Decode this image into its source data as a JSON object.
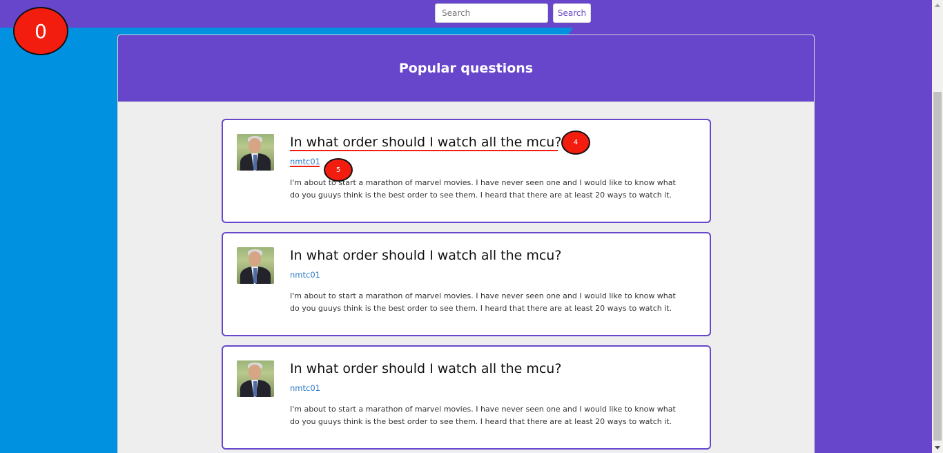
{
  "search": {
    "placeholder": "Search",
    "button_label": "Search"
  },
  "page": {
    "title": "Popular questions"
  },
  "overlay": {
    "badge_main": "0",
    "marker_title": "4",
    "marker_author": "5",
    "marker_color": "#f31d0f"
  },
  "colors": {
    "brand_purple": "#6746cc",
    "accent_blue": "#0091e1",
    "link_blue": "#2a78c8"
  },
  "questions": [
    {
      "title": "In what order should I watch all the mcu?",
      "author": "nmtc01",
      "body": "I'm about to start a marathon of marvel movies. I have never seen one and I would like to know what do you guuys think is the best order to see them. I heard that there are at least 20 ways to watch it."
    },
    {
      "title": "In what order should I watch all the mcu?",
      "author": "nmtc01",
      "body": "I'm about to start a marathon of marvel movies. I have never seen one and I would like to know what do you guuys think is the best order to see them. I heard that there are at least 20 ways to watch it."
    },
    {
      "title": "In what order should I watch all the mcu?",
      "author": "nmtc01",
      "body": "I'm about to start a marathon of marvel movies. I have never seen one and I would like to know what do you guuys think is the best order to see them. I heard that there are at least 20 ways to watch it."
    }
  ]
}
